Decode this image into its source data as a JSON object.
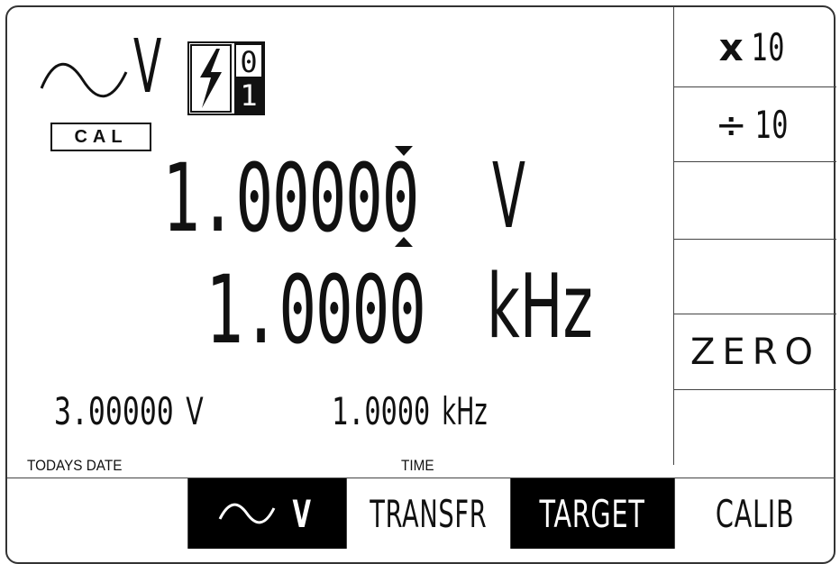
{
  "function_indicator": {
    "unit": "V",
    "range_top_digit": "0",
    "range_bottom_digit": "1"
  },
  "cal_badge": "CAL",
  "main_readout": {
    "value": "1.00000",
    "unit": "V"
  },
  "frequency_readout": {
    "value": "1.0000",
    "unit": "kHz"
  },
  "secondary": {
    "voltage": "3.00000",
    "voltage_unit": "V",
    "frequency": "1.0000",
    "frequency_unit": "kHz"
  },
  "status": {
    "date_label": "TODAYS DATE",
    "time_label": "TIME"
  },
  "right_keys": [
    {
      "prefix": "x",
      "value": "10"
    },
    {
      "prefix": "÷",
      "value": "10"
    },
    {
      "label": ""
    },
    {
      "label": ""
    },
    {
      "label": "ZERO"
    },
    {
      "label": ""
    }
  ],
  "bottom_keys": [
    {
      "label": ""
    },
    {
      "label": "V",
      "icon": "sine-wave-icon"
    },
    {
      "label": "TRANSFR"
    },
    {
      "label": "TARGET"
    },
    {
      "label": "CALIB"
    }
  ]
}
